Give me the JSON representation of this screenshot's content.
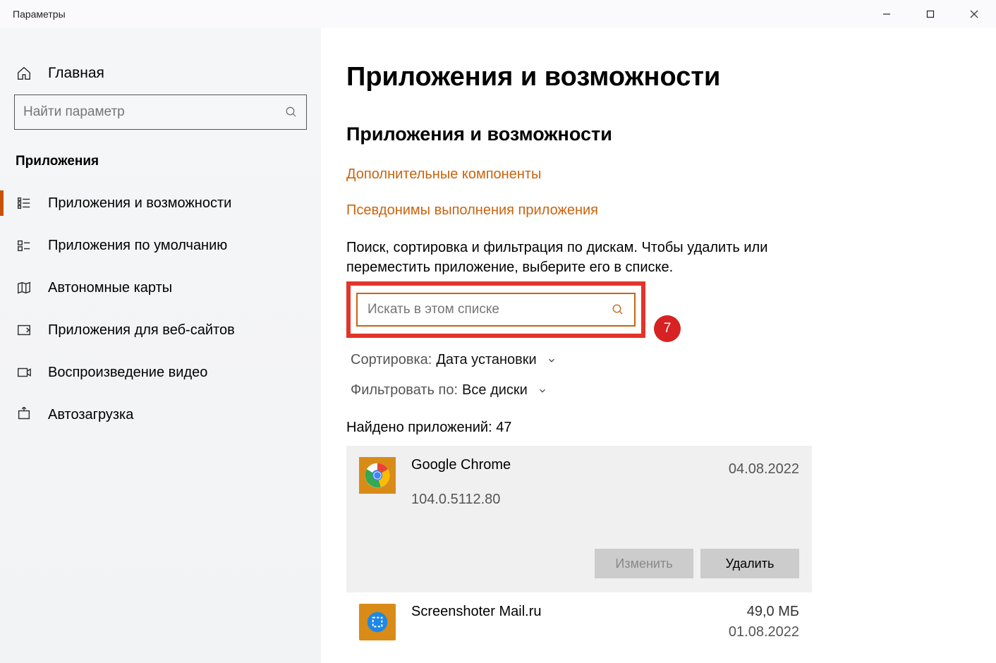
{
  "window": {
    "title": "Параметры"
  },
  "sidebar": {
    "home_label": "Главная",
    "search_placeholder": "Найти параметр",
    "section_header": "Приложения",
    "items": [
      {
        "label": "Приложения и возможности"
      },
      {
        "label": "Приложения по умолчанию"
      },
      {
        "label": "Автономные карты"
      },
      {
        "label": "Приложения для веб-сайтов"
      },
      {
        "label": "Воспроизведение видео"
      },
      {
        "label": "Автозагрузка"
      }
    ]
  },
  "main": {
    "page_title": "Приложения и возможности",
    "section_title": "Приложения и возможности",
    "links": {
      "optional": "Дополнительные компоненты",
      "aliases": "Псевдонимы выполнения приложения"
    },
    "description": "Поиск, сортировка и фильтрация по дискам. Чтобы удалить или переместить приложение, выберите его в списке.",
    "app_search_placeholder": "Искать в этом списке",
    "callout_number": "7",
    "sort": {
      "label": "Сортировка:",
      "value": "Дата установки"
    },
    "filter": {
      "label": "Фильтровать по:",
      "value": "Все диски"
    },
    "found_label": "Найдено приложений:",
    "found_count": "47",
    "apps": [
      {
        "name": "Google Chrome",
        "version": "104.0.5112.80",
        "size": "",
        "date": "04.08.2022"
      },
      {
        "name": "Screenshoter Mail.ru",
        "version": "",
        "size": "49,0 МБ",
        "date": "01.08.2022"
      }
    ],
    "actions": {
      "modify": "Изменить",
      "uninstall": "Удалить"
    }
  }
}
